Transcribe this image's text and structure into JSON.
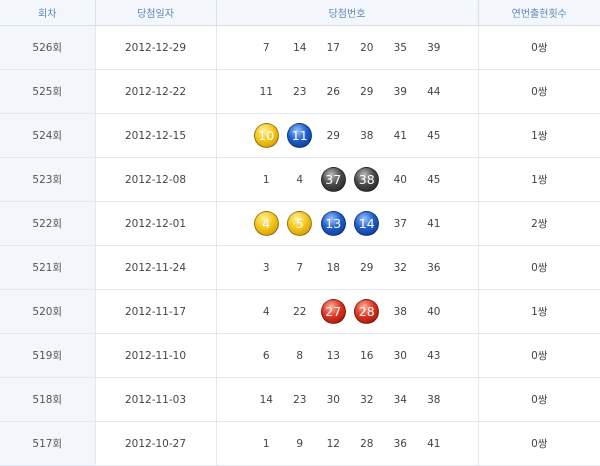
{
  "header": {
    "round": "회차",
    "date": "당첨일자",
    "numbers": "당첨번호",
    "count": "연번출현횟수"
  },
  "colors": {
    "yellow": "#f3c61a",
    "blue": "#1f5fcf",
    "gray": "#4a4a4a",
    "red": "#e0341f"
  },
  "rows": [
    {
      "round": "526회",
      "date": "2012-12-29",
      "numbers": [
        {
          "n": "7"
        },
        {
          "n": "14"
        },
        {
          "n": "17"
        },
        {
          "n": "20"
        },
        {
          "n": "35"
        },
        {
          "n": "39"
        }
      ],
      "count": "0쌍"
    },
    {
      "round": "525회",
      "date": "2012-12-22",
      "numbers": [
        {
          "n": "11"
        },
        {
          "n": "23"
        },
        {
          "n": "26"
        },
        {
          "n": "29"
        },
        {
          "n": "39"
        },
        {
          "n": "44"
        }
      ],
      "count": "0쌍"
    },
    {
      "round": "524회",
      "date": "2012-12-15",
      "numbers": [
        {
          "n": "10",
          "ball": "yellow"
        },
        {
          "n": "11",
          "ball": "blue"
        },
        {
          "n": "29"
        },
        {
          "n": "38"
        },
        {
          "n": "41"
        },
        {
          "n": "45"
        }
      ],
      "count": "1쌍"
    },
    {
      "round": "523회",
      "date": "2012-12-08",
      "numbers": [
        {
          "n": "1"
        },
        {
          "n": "4"
        },
        {
          "n": "37",
          "ball": "gray"
        },
        {
          "n": "38",
          "ball": "gray"
        },
        {
          "n": "40"
        },
        {
          "n": "45"
        }
      ],
      "count": "1쌍"
    },
    {
      "round": "522회",
      "date": "2012-12-01",
      "numbers": [
        {
          "n": "4",
          "ball": "yellow"
        },
        {
          "n": "5",
          "ball": "yellow"
        },
        {
          "n": "13",
          "ball": "blue"
        },
        {
          "n": "14",
          "ball": "blue"
        },
        {
          "n": "37"
        },
        {
          "n": "41"
        }
      ],
      "count": "2쌍"
    },
    {
      "round": "521회",
      "date": "2012-11-24",
      "numbers": [
        {
          "n": "3"
        },
        {
          "n": "7"
        },
        {
          "n": "18"
        },
        {
          "n": "29"
        },
        {
          "n": "32"
        },
        {
          "n": "36"
        }
      ],
      "count": "0쌍"
    },
    {
      "round": "520회",
      "date": "2012-11-17",
      "numbers": [
        {
          "n": "4"
        },
        {
          "n": "22"
        },
        {
          "n": "27",
          "ball": "red"
        },
        {
          "n": "28",
          "ball": "red"
        },
        {
          "n": "38"
        },
        {
          "n": "40"
        }
      ],
      "count": "1쌍"
    },
    {
      "round": "519회",
      "date": "2012-11-10",
      "numbers": [
        {
          "n": "6"
        },
        {
          "n": "8"
        },
        {
          "n": "13"
        },
        {
          "n": "16"
        },
        {
          "n": "30"
        },
        {
          "n": "43"
        }
      ],
      "count": "0쌍"
    },
    {
      "round": "518회",
      "date": "2012-11-03",
      "numbers": [
        {
          "n": "14"
        },
        {
          "n": "23"
        },
        {
          "n": "30"
        },
        {
          "n": "32"
        },
        {
          "n": "34"
        },
        {
          "n": "38"
        }
      ],
      "count": "0쌍"
    },
    {
      "round": "517회",
      "date": "2012-10-27",
      "numbers": [
        {
          "n": "1"
        },
        {
          "n": "9"
        },
        {
          "n": "12"
        },
        {
          "n": "28"
        },
        {
          "n": "36"
        },
        {
          "n": "41"
        }
      ],
      "count": "0쌍"
    }
  ]
}
